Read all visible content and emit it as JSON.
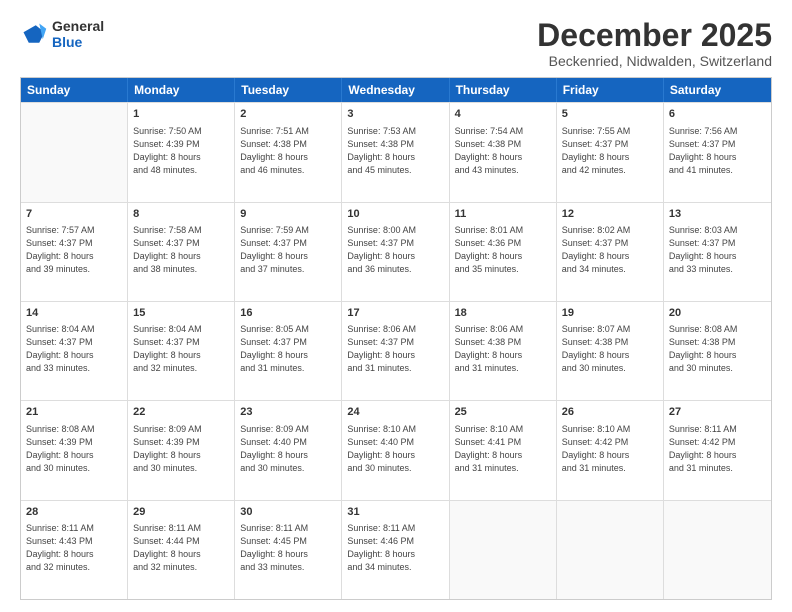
{
  "logo": {
    "line1": "General",
    "line2": "Blue"
  },
  "title": "December 2025",
  "subtitle": "Beckenried, Nidwalden, Switzerland",
  "header_days": [
    "Sunday",
    "Monday",
    "Tuesday",
    "Wednesday",
    "Thursday",
    "Friday",
    "Saturday"
  ],
  "weeks": [
    [
      {
        "day": "",
        "info": ""
      },
      {
        "day": "1",
        "info": "Sunrise: 7:50 AM\nSunset: 4:39 PM\nDaylight: 8 hours\nand 48 minutes."
      },
      {
        "day": "2",
        "info": "Sunrise: 7:51 AM\nSunset: 4:38 PM\nDaylight: 8 hours\nand 46 minutes."
      },
      {
        "day": "3",
        "info": "Sunrise: 7:53 AM\nSunset: 4:38 PM\nDaylight: 8 hours\nand 45 minutes."
      },
      {
        "day": "4",
        "info": "Sunrise: 7:54 AM\nSunset: 4:38 PM\nDaylight: 8 hours\nand 43 minutes."
      },
      {
        "day": "5",
        "info": "Sunrise: 7:55 AM\nSunset: 4:37 PM\nDaylight: 8 hours\nand 42 minutes."
      },
      {
        "day": "6",
        "info": "Sunrise: 7:56 AM\nSunset: 4:37 PM\nDaylight: 8 hours\nand 41 minutes."
      }
    ],
    [
      {
        "day": "7",
        "info": "Sunrise: 7:57 AM\nSunset: 4:37 PM\nDaylight: 8 hours\nand 39 minutes."
      },
      {
        "day": "8",
        "info": "Sunrise: 7:58 AM\nSunset: 4:37 PM\nDaylight: 8 hours\nand 38 minutes."
      },
      {
        "day": "9",
        "info": "Sunrise: 7:59 AM\nSunset: 4:37 PM\nDaylight: 8 hours\nand 37 minutes."
      },
      {
        "day": "10",
        "info": "Sunrise: 8:00 AM\nSunset: 4:37 PM\nDaylight: 8 hours\nand 36 minutes."
      },
      {
        "day": "11",
        "info": "Sunrise: 8:01 AM\nSunset: 4:36 PM\nDaylight: 8 hours\nand 35 minutes."
      },
      {
        "day": "12",
        "info": "Sunrise: 8:02 AM\nSunset: 4:37 PM\nDaylight: 8 hours\nand 34 minutes."
      },
      {
        "day": "13",
        "info": "Sunrise: 8:03 AM\nSunset: 4:37 PM\nDaylight: 8 hours\nand 33 minutes."
      }
    ],
    [
      {
        "day": "14",
        "info": "Sunrise: 8:04 AM\nSunset: 4:37 PM\nDaylight: 8 hours\nand 33 minutes."
      },
      {
        "day": "15",
        "info": "Sunrise: 8:04 AM\nSunset: 4:37 PM\nDaylight: 8 hours\nand 32 minutes."
      },
      {
        "day": "16",
        "info": "Sunrise: 8:05 AM\nSunset: 4:37 PM\nDaylight: 8 hours\nand 31 minutes."
      },
      {
        "day": "17",
        "info": "Sunrise: 8:06 AM\nSunset: 4:37 PM\nDaylight: 8 hours\nand 31 minutes."
      },
      {
        "day": "18",
        "info": "Sunrise: 8:06 AM\nSunset: 4:38 PM\nDaylight: 8 hours\nand 31 minutes."
      },
      {
        "day": "19",
        "info": "Sunrise: 8:07 AM\nSunset: 4:38 PM\nDaylight: 8 hours\nand 30 minutes."
      },
      {
        "day": "20",
        "info": "Sunrise: 8:08 AM\nSunset: 4:38 PM\nDaylight: 8 hours\nand 30 minutes."
      }
    ],
    [
      {
        "day": "21",
        "info": "Sunrise: 8:08 AM\nSunset: 4:39 PM\nDaylight: 8 hours\nand 30 minutes."
      },
      {
        "day": "22",
        "info": "Sunrise: 8:09 AM\nSunset: 4:39 PM\nDaylight: 8 hours\nand 30 minutes."
      },
      {
        "day": "23",
        "info": "Sunrise: 8:09 AM\nSunset: 4:40 PM\nDaylight: 8 hours\nand 30 minutes."
      },
      {
        "day": "24",
        "info": "Sunrise: 8:10 AM\nSunset: 4:40 PM\nDaylight: 8 hours\nand 30 minutes."
      },
      {
        "day": "25",
        "info": "Sunrise: 8:10 AM\nSunset: 4:41 PM\nDaylight: 8 hours\nand 31 minutes."
      },
      {
        "day": "26",
        "info": "Sunrise: 8:10 AM\nSunset: 4:42 PM\nDaylight: 8 hours\nand 31 minutes."
      },
      {
        "day": "27",
        "info": "Sunrise: 8:11 AM\nSunset: 4:42 PM\nDaylight: 8 hours\nand 31 minutes."
      }
    ],
    [
      {
        "day": "28",
        "info": "Sunrise: 8:11 AM\nSunset: 4:43 PM\nDaylight: 8 hours\nand 32 minutes."
      },
      {
        "day": "29",
        "info": "Sunrise: 8:11 AM\nSunset: 4:44 PM\nDaylight: 8 hours\nand 32 minutes."
      },
      {
        "day": "30",
        "info": "Sunrise: 8:11 AM\nSunset: 4:45 PM\nDaylight: 8 hours\nand 33 minutes."
      },
      {
        "day": "31",
        "info": "Sunrise: 8:11 AM\nSunset: 4:46 PM\nDaylight: 8 hours\nand 34 minutes."
      },
      {
        "day": "",
        "info": ""
      },
      {
        "day": "",
        "info": ""
      },
      {
        "day": "",
        "info": ""
      }
    ]
  ]
}
